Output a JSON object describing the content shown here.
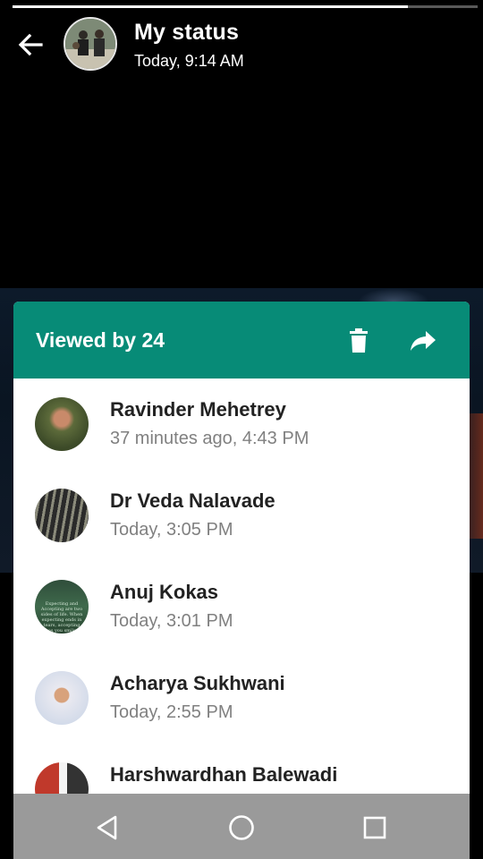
{
  "story": {
    "progress": 0.85
  },
  "header": {
    "title": "My status",
    "time": "Today, 9:14 AM",
    "back_icon": "arrow-left-icon"
  },
  "sheet": {
    "viewed_label": "Viewed by 24",
    "delete_icon": "trash-icon",
    "forward_icon": "forward-icon",
    "accent_color": "#078b77"
  },
  "viewers": [
    {
      "name": "Ravinder Mehetrey",
      "time": "37 minutes ago, 4:43 PM"
    },
    {
      "name": "Dr Veda Nalavade",
      "time": "Today, 3:05 PM"
    },
    {
      "name": "Anuj Kokas",
      "time": "Today, 3:01 PM",
      "avatar_text": "Expecting and Accepting are two sides of life. When expecting ends in tears, accepting makes you smile the way it is"
    },
    {
      "name": "Acharya Sukhwani",
      "time": "Today, 2:55 PM"
    },
    {
      "name": "Harshwardhan Balewadi",
      "time": ""
    }
  ],
  "navbar": {
    "back_icon": "triangle-back-icon",
    "home_icon": "circle-home-icon",
    "recents_icon": "square-recents-icon"
  }
}
